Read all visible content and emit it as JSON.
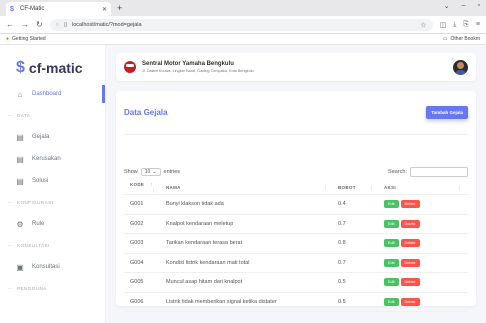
{
  "browser": {
    "tab_title": "CF-Matic",
    "url": "localhost/matic/?mod=gejala",
    "bookmark": "Getting Started",
    "other_bookmarks": "Other Bookm"
  },
  "sidebar": {
    "brand": "cf-matic",
    "items": [
      {
        "type": "item",
        "label": "Dashboard",
        "icon": "home-icon",
        "glyph": "⌂",
        "active": true
      },
      {
        "type": "header",
        "label": "DATA"
      },
      {
        "type": "item",
        "label": "Gejala",
        "icon": "table-icon",
        "glyph": "▤"
      },
      {
        "type": "item",
        "label": "Kerusakan",
        "icon": "table-icon",
        "glyph": "▤"
      },
      {
        "type": "item",
        "label": "Solusi",
        "icon": "table-icon",
        "glyph": "▤"
      },
      {
        "type": "header",
        "label": "KONFIGURASI"
      },
      {
        "type": "item",
        "label": "Rule",
        "icon": "gear-icon",
        "glyph": "⚙"
      },
      {
        "type": "header",
        "label": "KONSULTASI"
      },
      {
        "type": "item",
        "label": "Konsultasi",
        "icon": "clipboard-icon",
        "glyph": "▣"
      },
      {
        "type": "header",
        "label": "PENGGUNA"
      }
    ]
  },
  "header": {
    "store_name": "Sentral Motor Yamaha Bengkulu",
    "store_address": "Jl. Dalam Kouwa, Lingkar Barat, Gading Cempaka, Kota Bengkulu"
  },
  "card": {
    "title": "Data Gejala",
    "add_button": "Tambah Gejala"
  },
  "table": {
    "show_label": "Show",
    "entries_value": "10",
    "entries_label": "entries",
    "search_label": "Search:",
    "columns": [
      "KODE",
      "NAMA",
      "BOBOT",
      "AKSI"
    ],
    "edit_label": "Edit",
    "delete_label": "Delete",
    "rows": [
      {
        "kode": "G001",
        "nama": "Bunyi klakson tidak ada",
        "bobot": "0.4"
      },
      {
        "kode": "G002",
        "nama": "Knalpot kendaraan meletup",
        "bobot": "0.7"
      },
      {
        "kode": "G003",
        "nama": "Tarikan kendaraan terasa berat",
        "bobot": "0.8"
      },
      {
        "kode": "G004",
        "nama": "Kondisi listrik kendaraan mati total",
        "bobot": "0.7"
      },
      {
        "kode": "G005",
        "nama": "Muncul asap hitam dari knalpot",
        "bobot": "0.5"
      },
      {
        "kode": "G006",
        "nama": "Listrik tidak memberikan signal ketika distater",
        "bobot": "0.5"
      }
    ]
  },
  "colors": {
    "primary": "#6777ef",
    "success": "#47c363",
    "danger": "#fc544b"
  }
}
